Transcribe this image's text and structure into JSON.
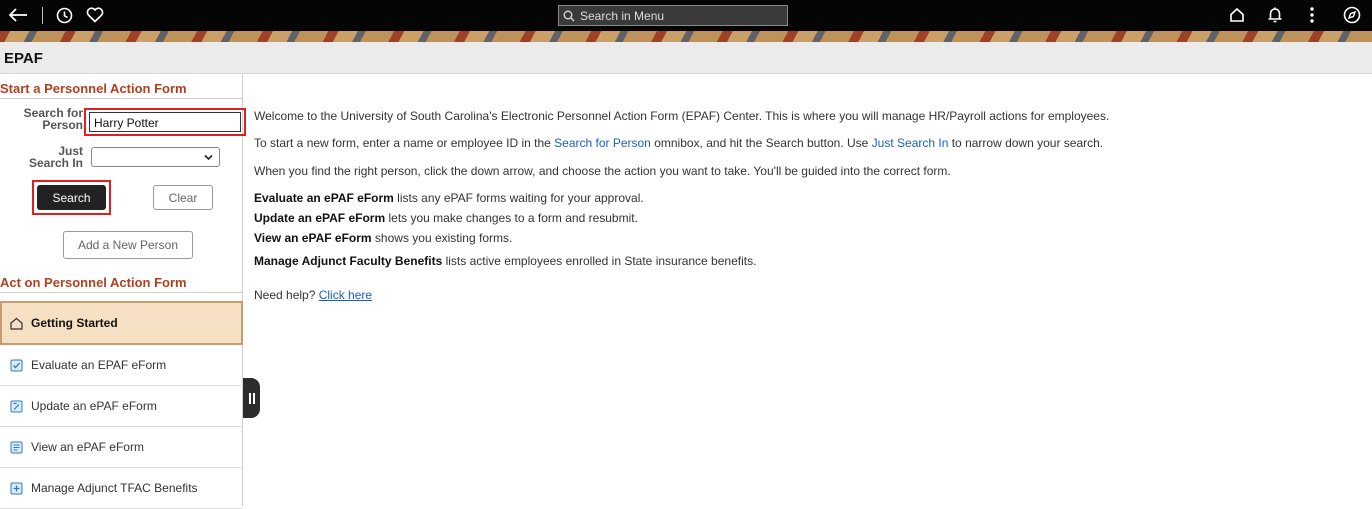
{
  "topbar": {
    "search_placeholder": "Search in Menu",
    "icons": [
      "back-arrow-icon",
      "history-clock-icon",
      "favorites-heart-icon",
      "home-icon",
      "notifications-bell-icon",
      "actions-menu-icon",
      "navbar-compass-icon"
    ]
  },
  "page": {
    "title": "EPAF"
  },
  "left": {
    "start_title": "Start a Personnel Action Form",
    "search_for_label": "Search for Person",
    "search_for_value": "Harry Potter",
    "just_search_in_label": "Just Search In",
    "just_search_in_value": "",
    "search_button": "Search",
    "clear_button": "Clear",
    "add_person_button": "Add a New Person",
    "act_title": "Act on Personnel Action Form",
    "nav": [
      {
        "label": "Getting Started",
        "icon": "home-icon"
      },
      {
        "label": "Evaluate an EPAF eForm",
        "icon": "evaluate-form-icon"
      },
      {
        "label": "Update an ePAF eForm",
        "icon": "update-form-icon"
      },
      {
        "label": "View an ePAF eForm",
        "icon": "view-form-icon"
      },
      {
        "label": "Manage Adjunct TFAC Benefits",
        "icon": "manage-benefits-icon"
      }
    ]
  },
  "main": {
    "welcome": "Welcome to the University of South Carolina's Electronic Personnel Action Form (EPAF) Center.  This is where you will manage HR/Payroll actions for employees.",
    "line2_a": "To start a new form, enter a name or employee ID in the ",
    "line2_hl1": "Search for Person",
    "line2_b": " omnibox, and hit the Search button. Use ",
    "line2_hl2": "Just Search In",
    "line2_c": " to narrow down your search.",
    "line3": "When you find the right person, click the down arrow, and choose the action you want to take. You'll be guided into the correct form.",
    "items": [
      {
        "bold": "Evaluate an ePAF eForm",
        "rest": " lists any ePAF forms waiting for your approval."
      },
      {
        "bold": "Update an ePAF eForm",
        "rest": " lets you make changes to a form and resubmit."
      },
      {
        "bold": "View an ePAF eForm",
        "rest": " shows you existing forms."
      },
      {
        "bold": "Manage Adjunct Faculty Benefits",
        "rest": " lists active employees enrolled in State insurance benefits."
      }
    ],
    "help_text": "Need help? ",
    "help_link": "Click here"
  },
  "colors": {
    "section_title": "#b04020",
    "highlight_box": "#e02020",
    "active_nav_bg": "#f6e0c4",
    "link": "#1a5fc4"
  }
}
